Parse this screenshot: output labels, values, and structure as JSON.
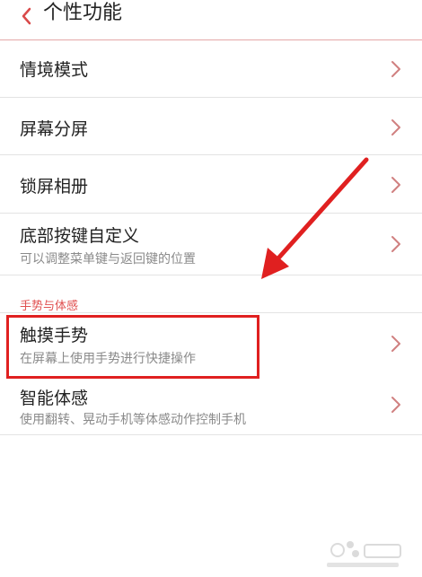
{
  "header": {
    "title": "个性功能",
    "back_icon": "chevron-left-icon"
  },
  "rows": [
    {
      "label": "情境模式"
    },
    {
      "label": "屏幕分屏"
    },
    {
      "label": "锁屏相册"
    },
    {
      "label": "底部按键自定义",
      "sub": "可以调整菜单键与返回键的位置"
    }
  ],
  "section": {
    "title": "手势与体感"
  },
  "section_rows": [
    {
      "label": "触摸手势",
      "sub": "在屏幕上使用手势进行快捷操作"
    },
    {
      "label": "智能体感",
      "sub": "使用翻转、晃动手机等体感动作控制手机"
    }
  ],
  "colors": {
    "accent_red": "#e05050",
    "annotation_red": "#e02020",
    "divider": "#e3e3e3"
  }
}
